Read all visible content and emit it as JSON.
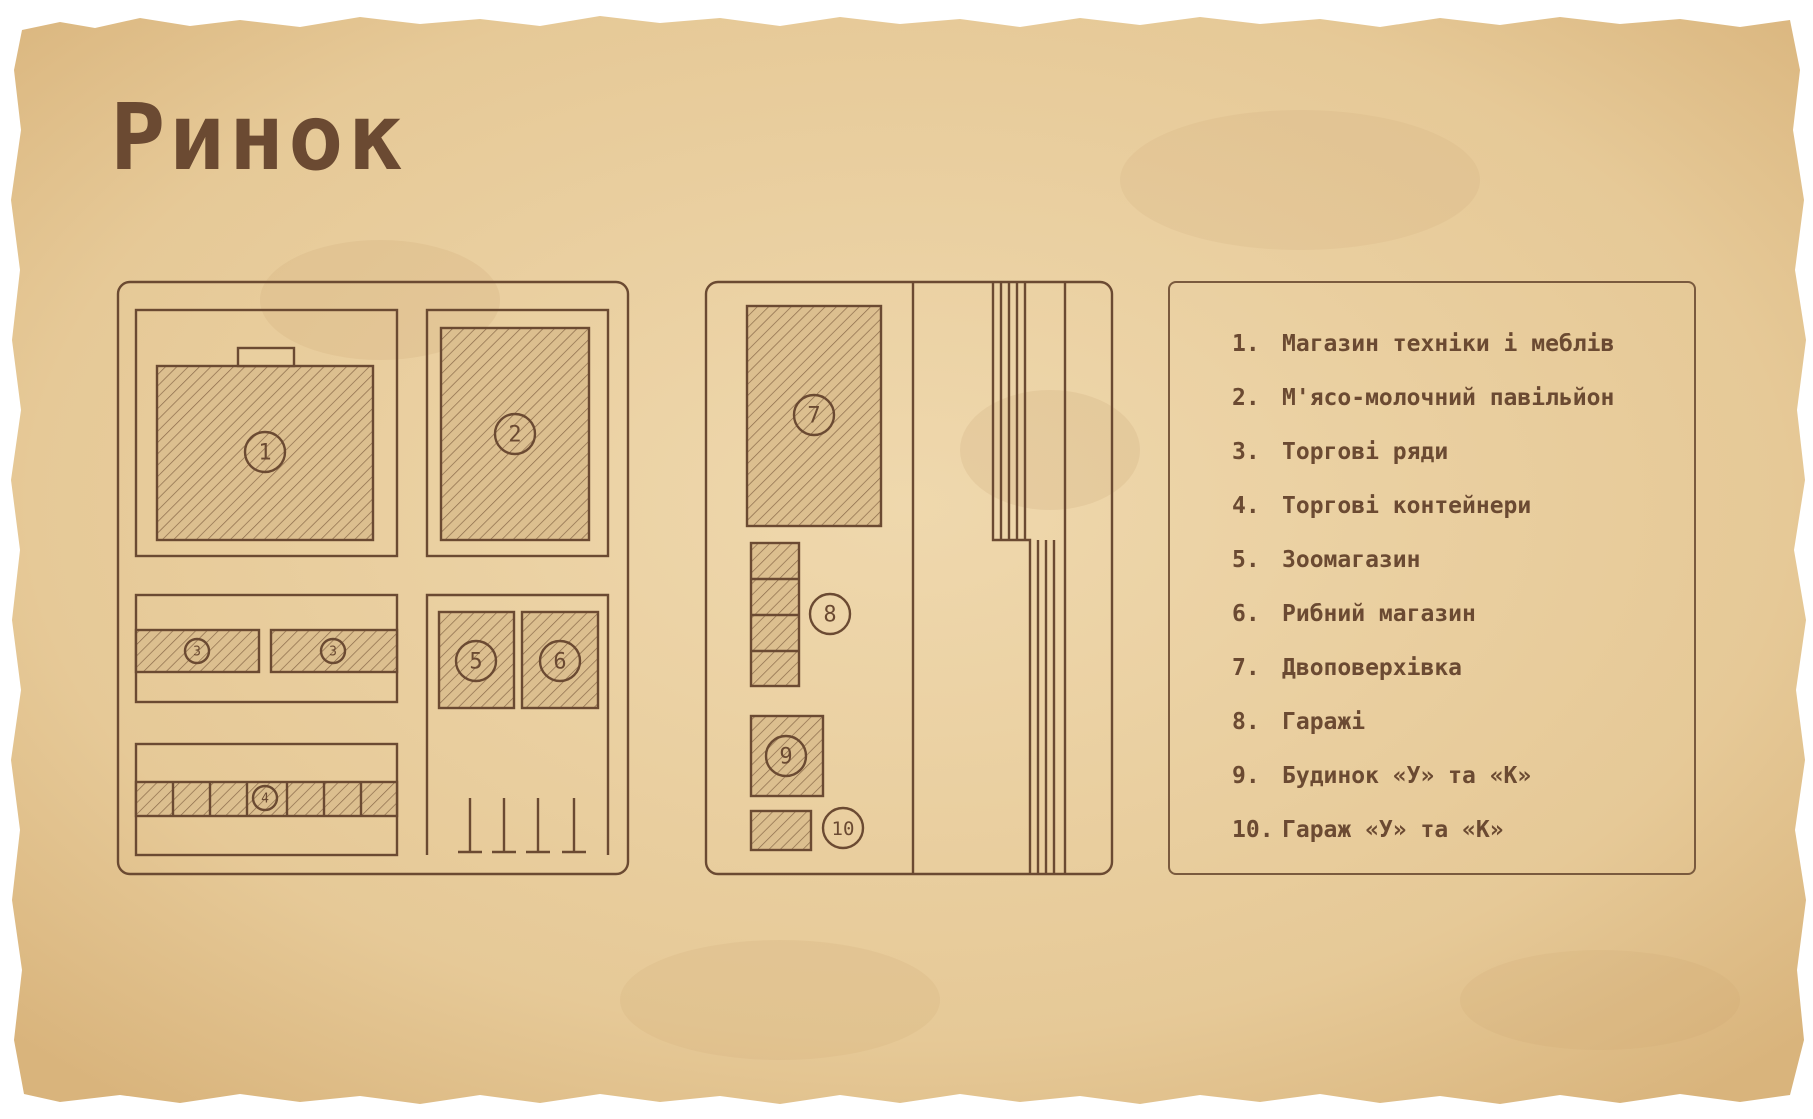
{
  "title": "Ринок",
  "colors": {
    "ink": "#6b4a32",
    "paper": "#e9cf9f",
    "hatch": "#d9bb8a"
  },
  "markers": [
    "1",
    "2",
    "3",
    "4",
    "5",
    "6",
    "7",
    "8",
    "9",
    "10"
  ],
  "legend": [
    {
      "num": "1.",
      "label": "Магазин техніки і меблів"
    },
    {
      "num": "2.",
      "label": "М'ясо-молочний павільйон"
    },
    {
      "num": "3.",
      "label": "Торгові ряди"
    },
    {
      "num": "4.",
      "label": "Торгові контейнери"
    },
    {
      "num": "5.",
      "label": "Зоомагазин"
    },
    {
      "num": "6.",
      "label": "Рибний магазин"
    },
    {
      "num": "7.",
      "label": "Двоповерхівка"
    },
    {
      "num": "8.",
      "label": "Гаражі"
    },
    {
      "num": "9.",
      "label": "Будинок «У» та «К»"
    },
    {
      "num": "10.",
      "label": "Гараж «У» та «К»"
    }
  ]
}
